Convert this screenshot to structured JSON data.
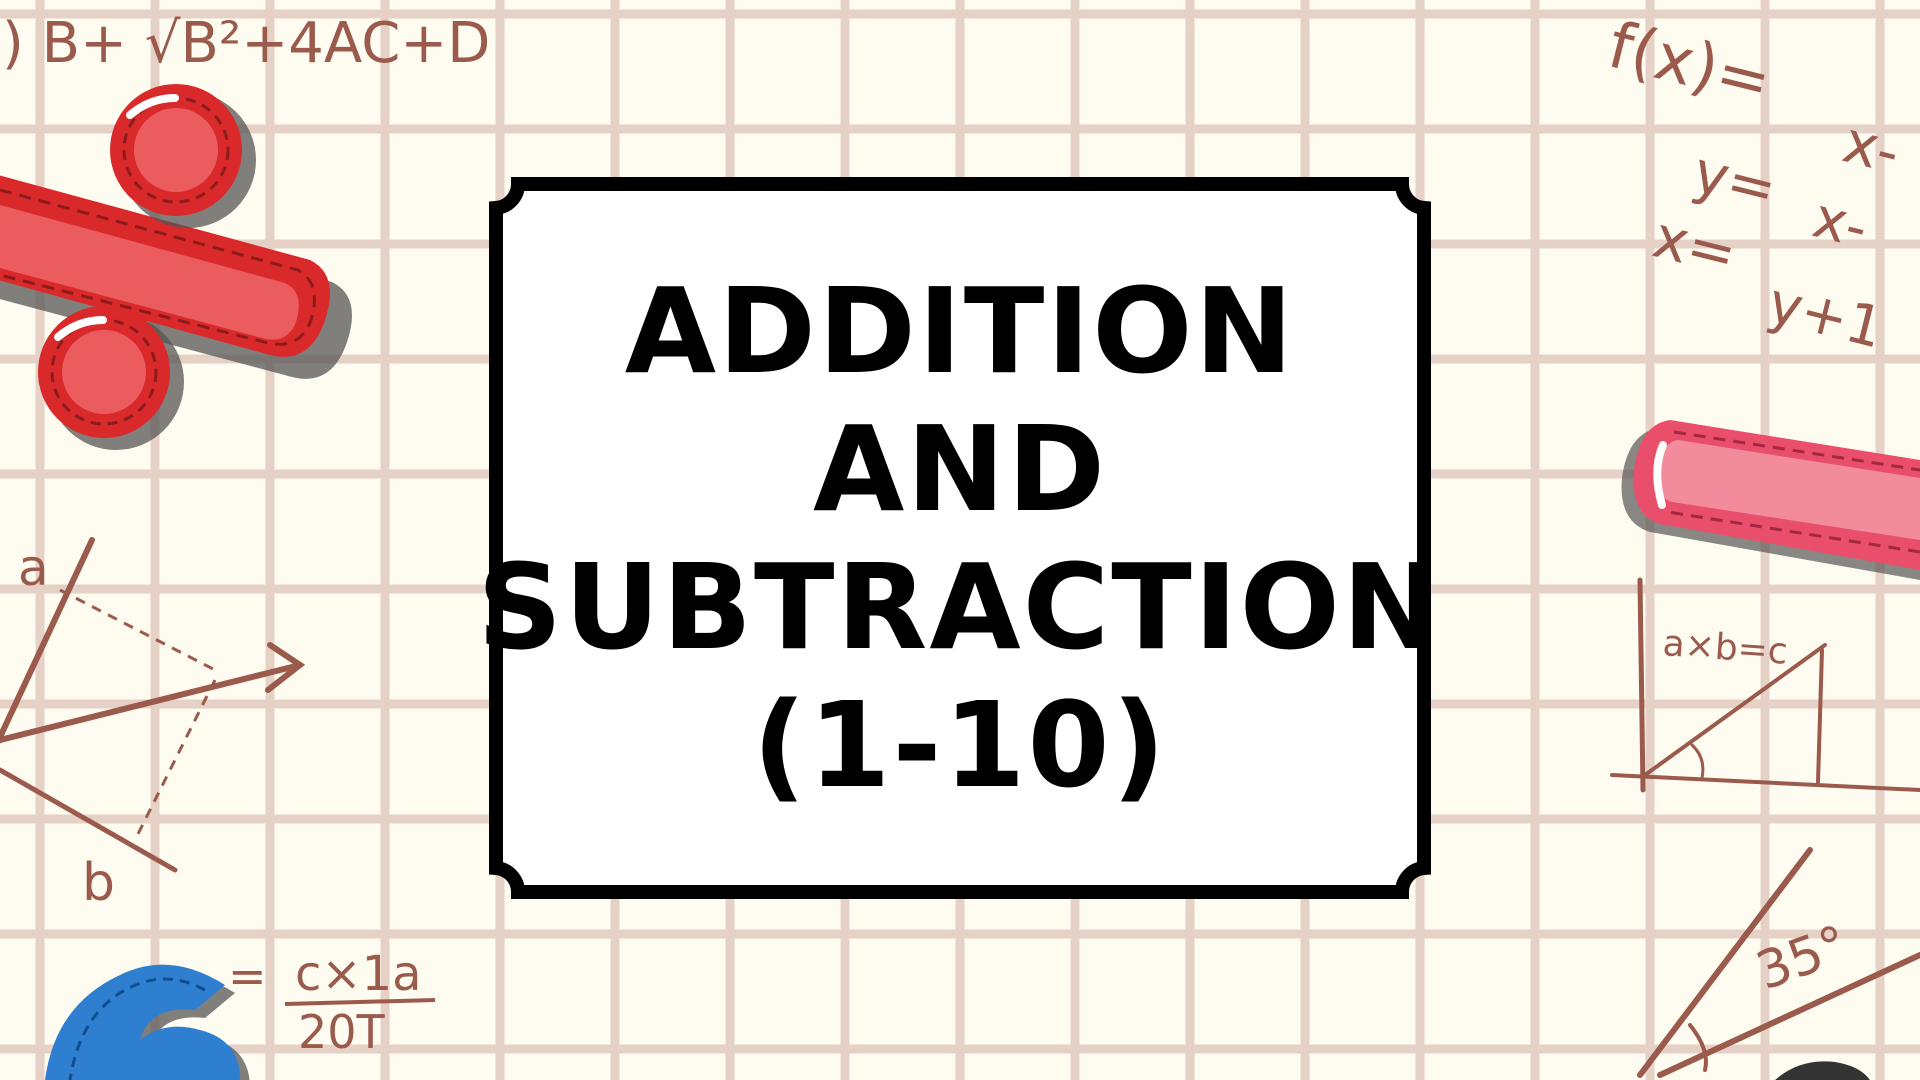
{
  "title": {
    "lines": [
      "ADDITION",
      "AND",
      "SUBTRACTION",
      "(1-10)"
    ]
  },
  "decorations": {
    "formula_top_left": ") B+ √B²+4AC+D",
    "formula_fx": "f(x)=",
    "formula_fx_rhs": "x-",
    "formula_y": "y=",
    "formula_y_rhs": "x-",
    "formula_x": "x=",
    "formula_x_rhs": "y+1",
    "formula_abc": "a×b=c",
    "angle_label": "35°",
    "fraction_eq": "=",
    "fraction_numerator": "c×1a",
    "fraction_denominator": "20T",
    "vector_label_a": "a",
    "vector_label_b": "b"
  },
  "colors": {
    "background": "#fefbf0",
    "grid": "#e6d1c6",
    "ink": "#9a5a4c",
    "card_fill": "#ffffff",
    "card_border": "#000000",
    "percent_red": "#d9292b",
    "pink_bar": "#e94f6a",
    "blue_digit": "#2f7fd1"
  },
  "icons": [
    "percent-sign-icon",
    "minus-sign-icon",
    "digit-six-icon"
  ]
}
